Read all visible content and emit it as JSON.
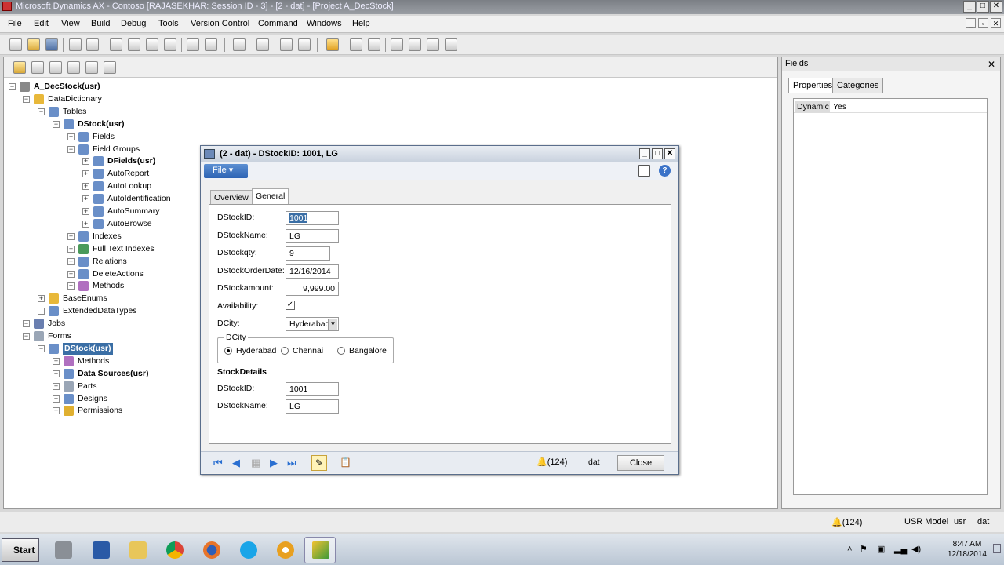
{
  "window": {
    "title": "Microsoft Dynamics AX - Contoso [RAJASEKHAR: Session ID - 3] - [2 - dat] - [Project A_DecStock]"
  },
  "menubar": {
    "items": [
      "File",
      "Edit",
      "View",
      "Build",
      "Debug",
      "Tools",
      "Version Control",
      "Command",
      "Windows",
      "Help"
    ]
  },
  "tree": {
    "root": "A_DecStock(usr)",
    "data_dictionary": "DataDictionary",
    "tables": "Tables",
    "dstock_table": "DStock(usr)",
    "fields": "Fields",
    "field_groups": "Field Groups",
    "dfields": "DFields(usr)",
    "autoreport": "AutoReport",
    "autolookup": "AutoLookup",
    "autoidentification": "AutoIdentification",
    "autosummary": "AutoSummary",
    "autobrowse": "AutoBrowse",
    "indexes": "Indexes",
    "fulltext": "Full Text Indexes",
    "relations": "Relations",
    "deleteactions": "DeleteActions",
    "methods": "Methods",
    "baseenums": "BaseEnums",
    "edt": "ExtendedDataTypes",
    "jobs": "Jobs",
    "forms": "Forms",
    "dstock_form": "DStock(usr)",
    "form_methods": "Methods",
    "datasources": "Data Sources(usr)",
    "parts": "Parts",
    "designs": "Designs",
    "permissions": "Permissions"
  },
  "fields_panel": {
    "title": "Fields",
    "tab_properties": "Properties",
    "tab_categories": "Categories",
    "prop_name": "Dynamic",
    "prop_value": "Yes"
  },
  "dialog": {
    "title": "(2 - dat) - DStockID: 1001, LG",
    "file_label": "File",
    "tab_overview": "Overview",
    "tab_general": "General",
    "labels": {
      "stockid": "DStockID:",
      "stockname": "DStockName:",
      "qty": "DStockqty:",
      "orderdate": "DStockOrderDate:",
      "amount": "DStockamount:",
      "availability": "Availability:",
      "city": "DCity:"
    },
    "values": {
      "stockid": "1001",
      "stockname": "LG",
      "qty": "9",
      "orderdate": "12/16/2014",
      "amount": "9,999.00",
      "availability": true,
      "city": "Hyderabad"
    },
    "radio_group": {
      "label": "DCity",
      "options": [
        "Hyderabad",
        "Chennai",
        "Bangalore"
      ],
      "selected": "Hyderabad"
    },
    "stock_details": {
      "heading": "StockDetails",
      "stockid_label": "DStockID:",
      "stockid_value": "1001",
      "stockname_label": "DStockName:",
      "stockname_value": "LG"
    },
    "nav": {
      "alerts": "(124)",
      "company": "dat",
      "close_label": "Close"
    }
  },
  "statusbar": {
    "alerts": "(124)",
    "model": "USR Model",
    "layer": "usr",
    "company": "dat"
  },
  "taskbar": {
    "start": "Start",
    "time": "8:47 AM",
    "date": "12/18/2014"
  }
}
